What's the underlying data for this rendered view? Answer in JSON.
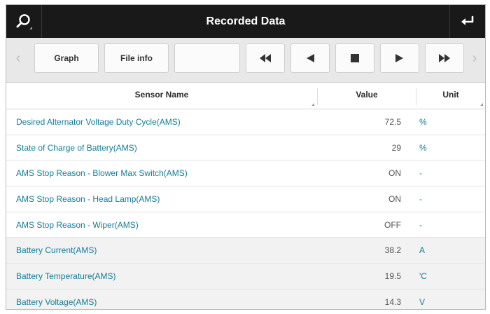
{
  "header": {
    "title": "Recorded Data",
    "left_icon": "search-icon",
    "right_icon": "return-icon"
  },
  "toolbar": {
    "prev_arrow": "‹",
    "next_arrow": "›",
    "graph_label": "Graph",
    "fileinfo_label": "File info"
  },
  "table": {
    "columns": {
      "name": "Sensor Name",
      "value": "Value",
      "unit": "Unit"
    },
    "rows": [
      {
        "name": "Desired Alternator Voltage Duty Cycle(AMS)",
        "value": "72.5",
        "unit": "%"
      },
      {
        "name": "State of Charge of Battery(AMS)",
        "value": "29",
        "unit": "%"
      },
      {
        "name": "AMS Stop Reason - Blower Max Switch(AMS)",
        "value": "ON",
        "unit": "-"
      },
      {
        "name": "AMS Stop Reason - Head Lamp(AMS)",
        "value": "ON",
        "unit": "-"
      },
      {
        "name": "AMS Stop Reason - Wiper(AMS)",
        "value": "OFF",
        "unit": "-"
      },
      {
        "name": "Battery Current(AMS)",
        "value": "38.2",
        "unit": "A"
      },
      {
        "name": "Battery Temperature(AMS)",
        "value": "19.5",
        "unit": "'C"
      },
      {
        "name": "Battery Voltage(AMS)",
        "value": "14.3",
        "unit": "V"
      }
    ]
  },
  "colors": {
    "titlebar": "#191919",
    "accent_text": "#167c97",
    "toolbar_bg": "#e8e8e8"
  }
}
